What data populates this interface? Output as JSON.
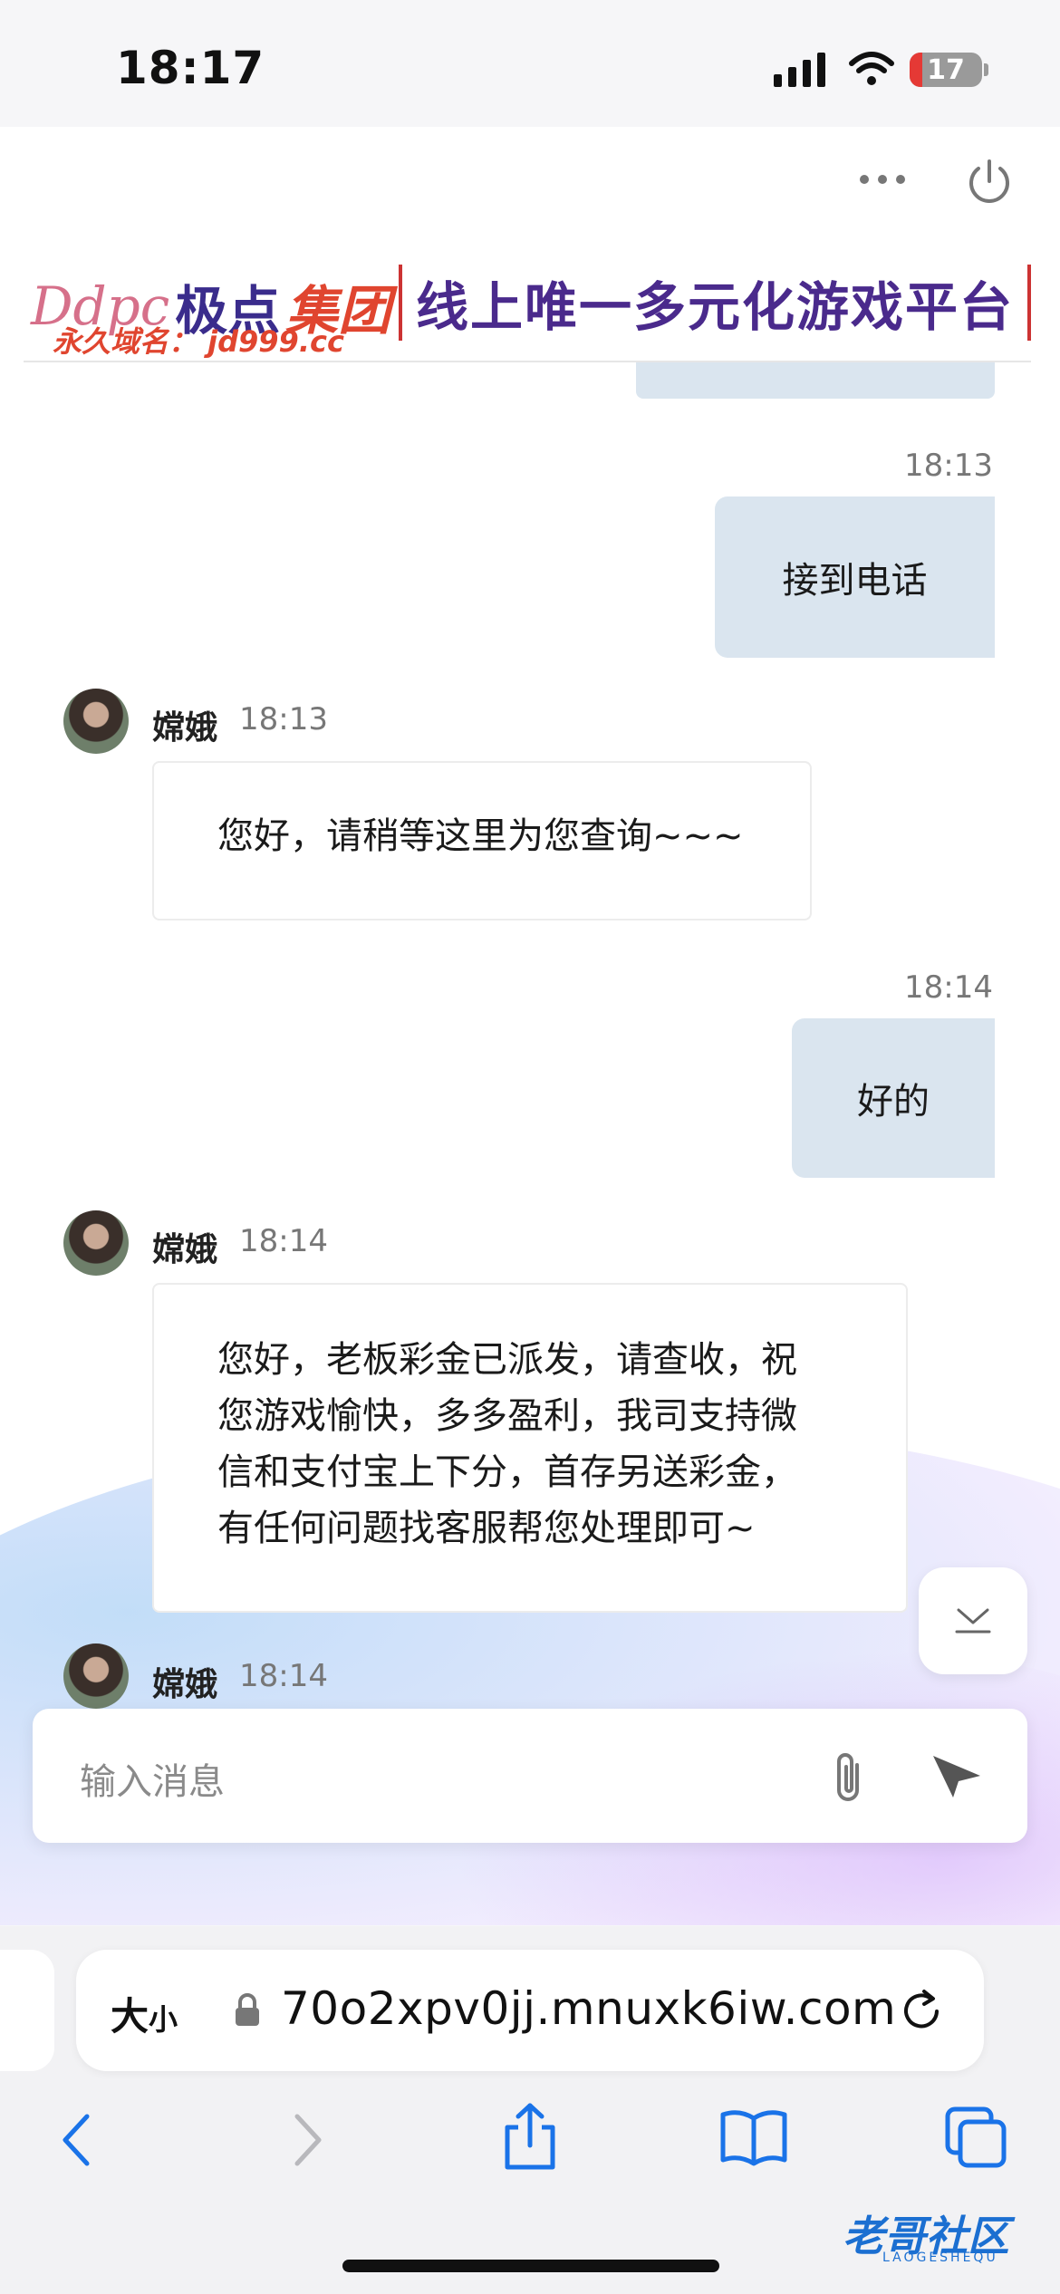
{
  "status_bar": {
    "time": "18:17",
    "battery": "17"
  },
  "banner": {
    "logo_en": "Ddpc",
    "logo_cn": "极点",
    "logo_group": "集团",
    "domain_text": "永久域名： jd999.cc",
    "slogan": "线上唯一多元化游戏平台"
  },
  "messages": {
    "m1": {
      "time": "18:13",
      "text": "接到电话"
    },
    "m2": {
      "sender": "嫦娥",
      "time": "18:13",
      "text": "您好，请稍等这里为您查询~~~"
    },
    "m3": {
      "time": "18:14",
      "text": "好的"
    },
    "m4": {
      "sender": "嫦娥",
      "time": "18:14",
      "lines": [
        "您好，老板彩金已派发，请查收，祝",
        "您游戏愉快，多多盈利，我司支持微",
        "信和支付宝上下分，首存另送彩金，",
        "有任何问题找客服帮您处理即可~"
      ]
    },
    "m5": {
      "sender": "嫦娥",
      "time": "18:14"
    }
  },
  "composer": {
    "placeholder": "输入消息"
  },
  "safari": {
    "text_size_label": "大",
    "text_size_small": "小",
    "url": "70o2xpv0jj.mnuxk6iw.com"
  },
  "watermark": {
    "text": "老哥社区",
    "sub": "LAOGESHEQU"
  },
  "colors": {
    "bubble_right": "#dae5ef",
    "accent": "#1a73e8"
  }
}
